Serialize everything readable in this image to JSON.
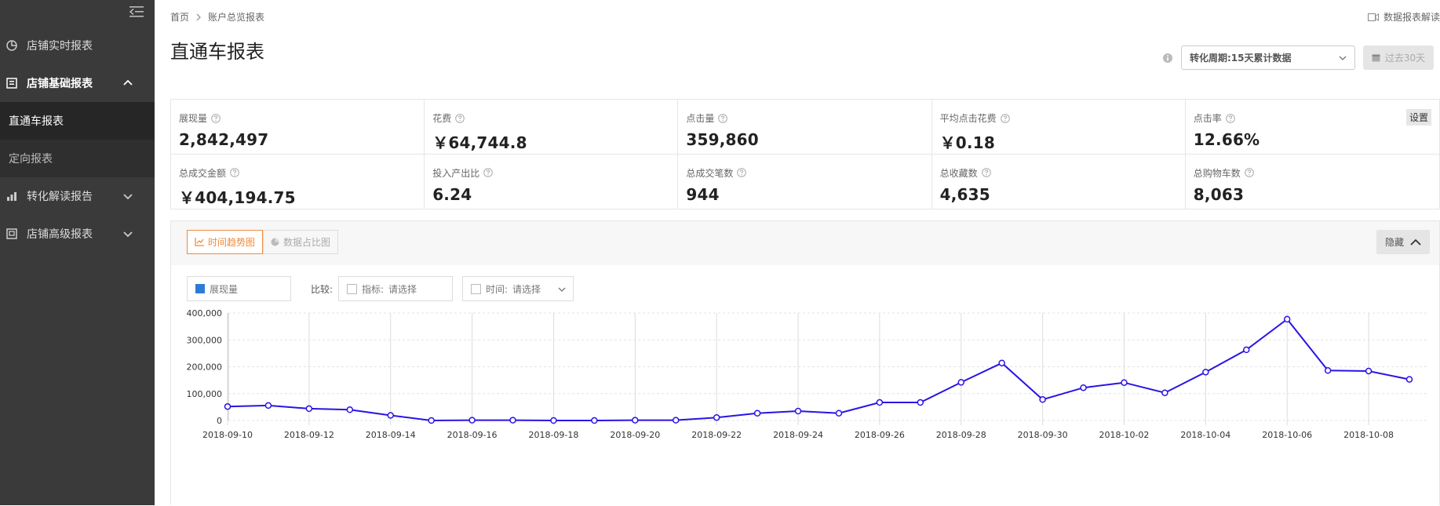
{
  "sidebar": {
    "items": [
      {
        "label": "店铺实时报表"
      },
      {
        "label": "店铺基础报表"
      },
      {
        "label": "直通车报表"
      },
      {
        "label": "定向报表"
      },
      {
        "label": "转化解读报告"
      },
      {
        "label": "店铺高级报表"
      }
    ]
  },
  "breadcrumb": {
    "home": "首页",
    "current": "账户总览报表"
  },
  "help_link": "数据报表解读",
  "page_title": "直通车报表",
  "toolbar": {
    "period_select": "转化周期:15天累计数据",
    "date_range": "过去30天"
  },
  "kpis": [
    {
      "label": "展现量",
      "value": "2,842,497"
    },
    {
      "label": "花费",
      "value": "￥64,744.8"
    },
    {
      "label": "点击量",
      "value": "359,860"
    },
    {
      "label": "平均点击花费",
      "value": "￥0.18"
    },
    {
      "label": "点击率",
      "value": "12.66%"
    },
    {
      "label": "总成交金额",
      "value": "￥404,194.75"
    },
    {
      "label": "投入产出比",
      "value": "6.24"
    },
    {
      "label": "总成交笔数",
      "value": "944"
    },
    {
      "label": "总收藏数",
      "value": "4,635"
    },
    {
      "label": "总购物车数",
      "value": "8,063"
    }
  ],
  "settings_label": "设置",
  "tabs": {
    "trend": "时间趋势图",
    "share": "数据占比图"
  },
  "hide_label": "隐藏",
  "filters": {
    "metric": "展现量",
    "compare_label": "比较:",
    "indicator_label": "指标:",
    "indicator_placeholder": "请选择",
    "time_label": "时间:",
    "time_placeholder": "请选择"
  },
  "colors": {
    "line": "#2a13e6",
    "accent": "#f08a3c",
    "sidebar_bg": "#3a3a3a"
  },
  "chart_data": {
    "type": "line",
    "x": [
      "2018-09-10",
      "2018-09-11",
      "2018-09-12",
      "2018-09-13",
      "2018-09-14",
      "2018-09-15",
      "2018-09-16",
      "2018-09-17",
      "2018-09-18",
      "2018-09-19",
      "2018-09-20",
      "2018-09-21",
      "2018-09-22",
      "2018-09-23",
      "2018-09-24",
      "2018-09-25",
      "2018-09-26",
      "2018-09-27",
      "2018-09-28",
      "2018-09-29",
      "2018-09-30",
      "2018-10-01",
      "2018-10-02",
      "2018-10-03",
      "2018-10-04",
      "2018-10-05",
      "2018-10-06",
      "2018-10-07",
      "2018-10-08",
      "2018-10-09"
    ],
    "x_tick_labels": [
      "2018-09-10",
      "2018-09-12",
      "2018-09-14",
      "2018-09-16",
      "2018-09-18",
      "2018-09-20",
      "2018-09-22",
      "2018-09-24",
      "2018-09-26",
      "2018-09-28",
      "2018-09-30",
      "2018-10-02",
      "2018-10-04",
      "2018-10-06",
      "2018-10-08"
    ],
    "series": [
      {
        "values": [
          52000,
          56000,
          44000,
          40000,
          19000,
          0,
          1000,
          1000,
          0,
          0,
          1000,
          1000,
          11000,
          27000,
          35000,
          27000,
          67000,
          67000,
          142000,
          214000,
          78000,
          122000,
          141000,
          103000,
          180000,
          263000,
          377000,
          186000,
          184000,
          153000
        ]
      }
    ],
    "ylim": [
      0,
      400000
    ],
    "y_ticks": [
      0,
      100000,
      200000,
      300000,
      400000
    ],
    "y_tick_labels": [
      "0",
      "100,000",
      "200,000",
      "300,000",
      "400,000"
    ],
    "grid": true,
    "legend": "none"
  }
}
